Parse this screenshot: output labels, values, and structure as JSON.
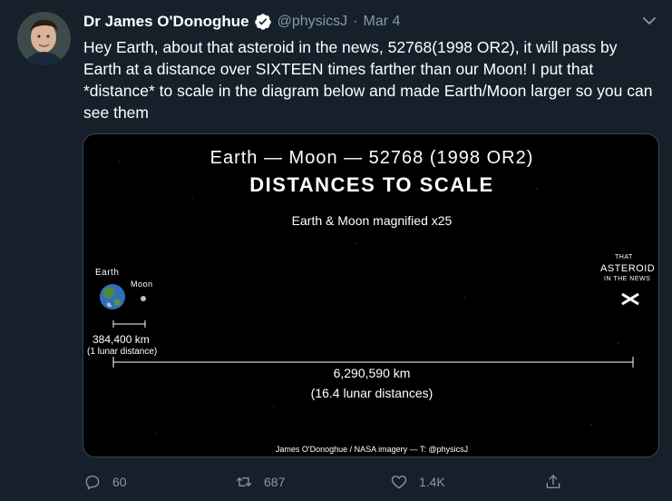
{
  "tweet": {
    "author_name": "Dr James O'Donoghue",
    "handle": "@physicsJ",
    "separator": "·",
    "date": "Mar 4",
    "text": "Hey Earth, about that asteroid in the news, 52768(1998 OR2), it will pass by Earth at a distance over SIXTEEN times farther than our Moon! I put that *distance* to scale in the diagram below and made Earth/Moon larger so you can see them"
  },
  "media": {
    "title_line1": "Earth — Moon — 52768 (1998 OR2)",
    "title_line2": "DISTANCES TO SCALE",
    "magnified": "Earth & Moon magnified x25",
    "earth_label": "Earth",
    "moon_label": "Moon",
    "asteroid_label_top": "THAT",
    "asteroid_label_mid": "ASTEROID",
    "asteroid_label_bottom": "IN THE NEWS",
    "moon_distance_km": "384,400 km",
    "moon_distance_ld": "(1 lunar distance)",
    "asteroid_distance_km": "6,290,590 km",
    "asteroid_distance_ld": "(16.4 lunar distances)",
    "credit": "James O'Donoghue / NASA imagery — T: @physicsJ"
  },
  "actions": {
    "replies": "60",
    "retweets": "687",
    "likes": "1.4K"
  },
  "colors": {
    "background": "#15202b",
    "muted": "#8899a6",
    "verified": "#1da1f2"
  }
}
